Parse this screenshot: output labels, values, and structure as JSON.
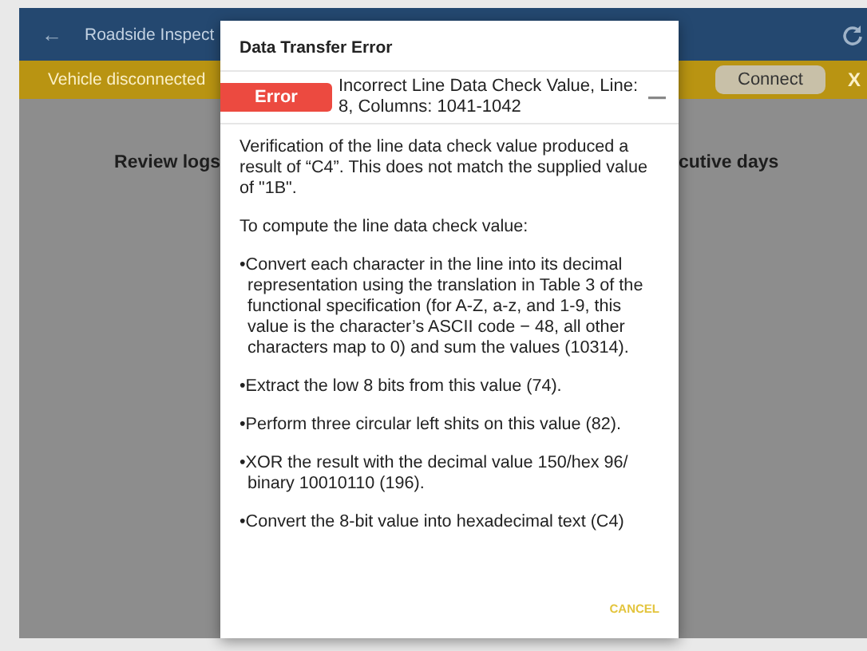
{
  "app_bar": {
    "back": "←",
    "title": "Roadside Inspect"
  },
  "banner": {
    "message": "Vehicle disconnected",
    "button": "Connect",
    "close": "X"
  },
  "page": {
    "heading_left": "Review logs",
    "heading_right": "cutive days"
  },
  "dialog": {
    "title": "Data Transfer Error",
    "error": {
      "badge": "Error",
      "message": "Incorrect Line Data Check Value, Line: 8, Columns: 1041-1042"
    },
    "paragraphs": [
      "Verification of the line data check value produced a result of “C4”. This does not match the supplied value of \"1B\".",
      "To compute the line data check value:"
    ],
    "steps": [
      "•Convert each character in the line into its decimal representation using the translation in Table 3 of the functional specification (for A-Z, a-z, and 1-9, this value is the character’s ASCII code − 48, all other characters map to 0) and sum the values (10314).",
      "•Extract the low 8 bits from this value (74).",
      "•Perform three circular left shits on this value (82).",
      "•XOR the result with the decimal value 150/hex 96/ binary 10010110 (196).",
      "•Convert the 8-bit value into hexadecimal text (C4)"
    ],
    "buttons": [
      "CANCEL"
    ]
  }
}
